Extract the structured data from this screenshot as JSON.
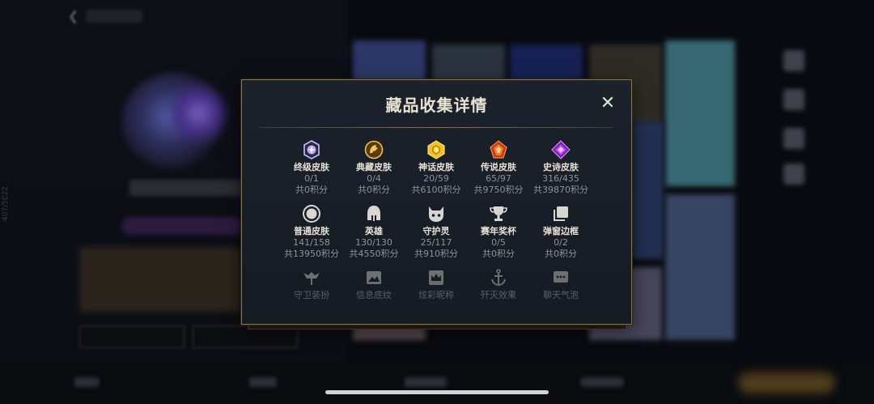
{
  "background": {
    "side_text": "407/5E22"
  },
  "modal": {
    "title": "藏品收集详情",
    "close_label": "✕",
    "rows": [
      [
        {
          "name": "终级皮肤",
          "count": "0/1",
          "points": "共0积分",
          "icon": "ultimate-skin-icon",
          "color": "#b7a6ff"
        },
        {
          "name": "典藏皮肤",
          "count": "0/4",
          "points": "共0积分",
          "icon": "collection-skin-icon",
          "color": "#e0a83a"
        },
        {
          "name": "神话皮肤",
          "count": "20/59",
          "points": "共6100积分",
          "icon": "mythic-skin-icon",
          "color": "#f2c21b"
        },
        {
          "name": "传说皮肤",
          "count": "65/97",
          "points": "共9750积分",
          "icon": "legendary-skin-icon",
          "color": "#e8571f"
        },
        {
          "name": "史诗皮肤",
          "count": "316/435",
          "points": "共39870积分",
          "icon": "epic-skin-icon",
          "color": "#a63ad6"
        }
      ],
      [
        {
          "name": "普通皮肤",
          "count": "141/158",
          "points": "共13950积分",
          "icon": "normal-skin-icon",
          "color": "#d9d6cf"
        },
        {
          "name": "英雄",
          "count": "130/130",
          "points": "共4550积分",
          "icon": "hero-helmet-icon",
          "color": "#d9d6cf"
        },
        {
          "name": "守护灵",
          "count": "25/117",
          "points": "共910积分",
          "icon": "guardian-spirit-icon",
          "color": "#d9d6cf"
        },
        {
          "name": "赛年奖杯",
          "count": "0/5",
          "points": "共0积分",
          "icon": "trophy-icon",
          "color": "#d9d6cf"
        },
        {
          "name": "弹窗边框",
          "count": "0/2",
          "points": "共0积分",
          "icon": "popup-frame-icon",
          "color": "#d9d6cf"
        }
      ],
      [
        {
          "name": "守卫装扮",
          "icon": "ward-skin-icon",
          "color": "#b9b6b0"
        },
        {
          "name": "信息底纹",
          "icon": "info-background-icon",
          "color": "#b9b6b0"
        },
        {
          "name": "炫彩昵称",
          "icon": "colorful-nickname-icon",
          "color": "#b9b6b0"
        },
        {
          "name": "歼灭效果",
          "icon": "kill-effect-icon",
          "color": "#b9b6b0"
        },
        {
          "name": "聊天气泡",
          "icon": "chat-bubble-icon",
          "color": "#b9b6b0"
        }
      ]
    ]
  }
}
